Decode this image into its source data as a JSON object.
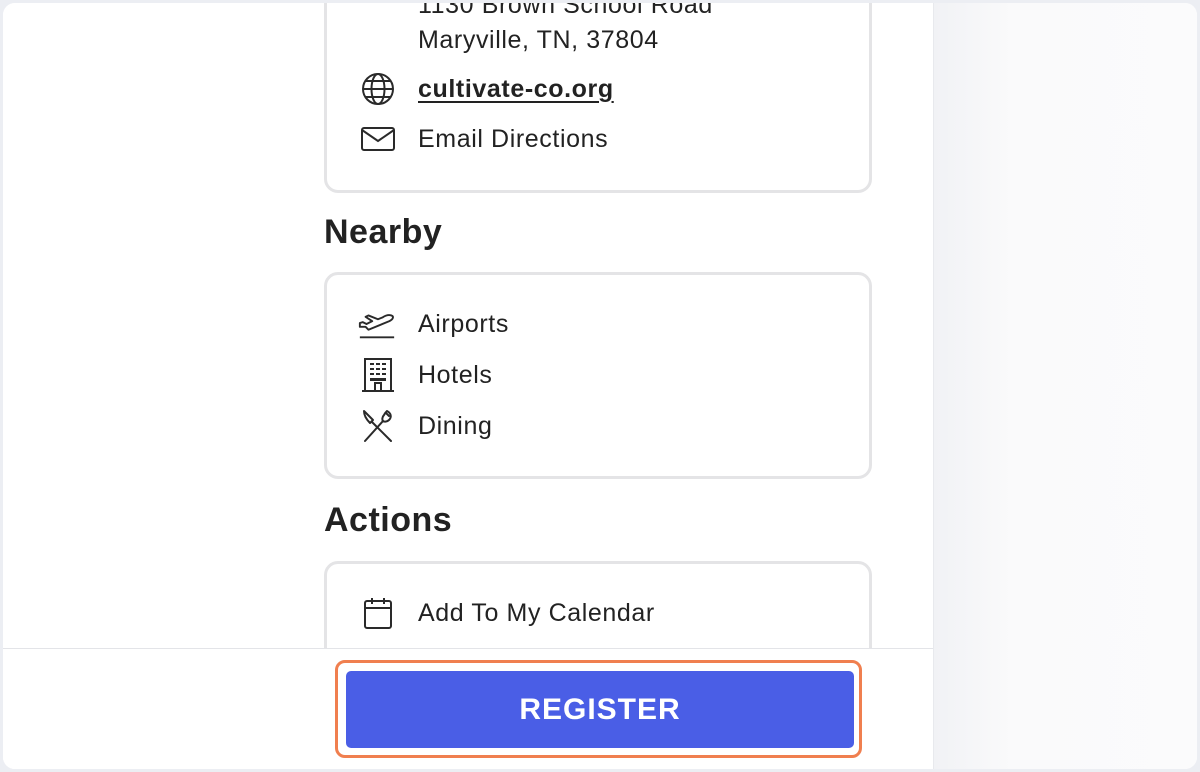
{
  "location": {
    "address_line1": "1130 Brown School Road",
    "address_line2": "Maryville, TN, 37804",
    "website": "cultivate-co.org",
    "email_directions": "Email Directions"
  },
  "nearby": {
    "heading": "Nearby",
    "items": [
      {
        "label": "Airports",
        "icon": "airplane-icon"
      },
      {
        "label": "Hotels",
        "icon": "hotel-icon"
      },
      {
        "label": "Dining",
        "icon": "dining-icon"
      }
    ]
  },
  "actions": {
    "heading": "Actions",
    "items": [
      {
        "label": "Add To My Calendar",
        "icon": "calendar-icon"
      }
    ]
  },
  "footer": {
    "register_label": "REGISTER"
  },
  "colors": {
    "register_button": "#4a5ee6",
    "highlight_outline": "#f07f4f"
  }
}
